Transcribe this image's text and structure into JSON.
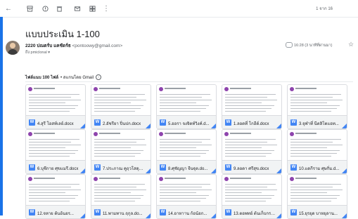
{
  "toolbar": {
    "icons": [
      "back-arrow-icon",
      "archive-icon",
      "report-spam-icon",
      "delete-icon",
      "mark-unread-icon",
      "move-to-icon",
      "more-vert-icon"
    ],
    "count": "1 จาก 16"
  },
  "email": {
    "subject": "แบบประเมิน 1-100",
    "sender_name": "2220 ปณตร์บ แคชัดร์ธ",
    "sender_email": "<pontoowy@gmail.com>",
    "to_line": "ถึง pmiclonal ▾",
    "date_meta": "16:28 (3 นาทีที่ผ่านมา)"
  },
  "attachments": {
    "summary_bold": "ไฟล์แนบ 100 ไฟล์",
    "summary_rest": "• สแกนโดย Gmail",
    "items": [
      "4.สุรี โอสท์เลย์.docx",
      "2.อัชรียา ปิ่นปก.docx",
      "5.ออรา จงจิตท์วิงค์.d...",
      "1.ลอดที่ โกฮีต์.docx",
      "3.จุฬาที่ นีตลิโตแอท...",
      "6.บุชีกาย ศุขแมรี.docx",
      "7.ประภาณ คูฤวโสดุล...",
      "8.ศุชัญญา จีนฐุต.do...",
      "9.ลอดา ศรีสุข.docx",
      "10.แดกีราม ศุษกิ่ม.d...",
      "12.จหาย ต้นอ้นอร...",
      "11.พามทาน ฤกุล.do...",
      "14.อาหาาน ก้อน้อก...",
      "13.ตอพทย์ ต้นเก็บกรม...",
      "15.ยุรยุด บาหยุลาน..."
    ]
  }
}
